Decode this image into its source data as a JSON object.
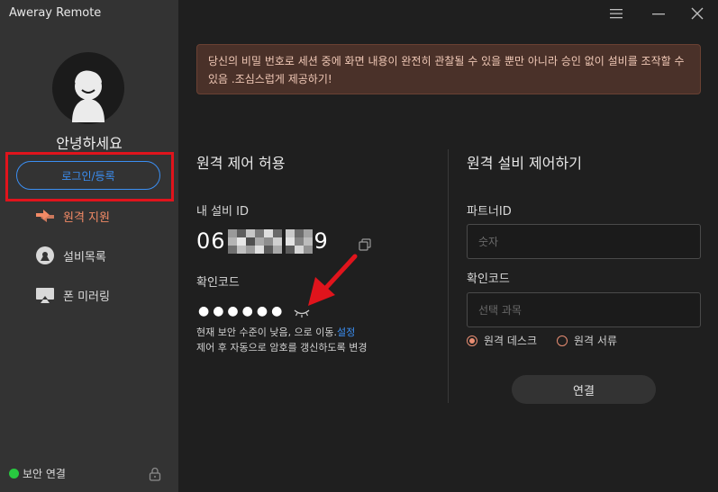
{
  "app": {
    "title": "Aweray Remote"
  },
  "sidebar": {
    "greeting": "안녕하세요",
    "login_label": "로그인/등록",
    "items": [
      {
        "label": "원격 지원",
        "icon": "remote-support-icon",
        "active": true
      },
      {
        "label": "설비목록",
        "icon": "device-list-icon",
        "active": false
      },
      {
        "label": "폰 미러링",
        "icon": "phone-mirroring-icon",
        "active": false
      }
    ],
    "status": "보안 연결"
  },
  "window_controls": [
    "menu-icon",
    "minimize-icon",
    "close-icon"
  ],
  "warning": "당신의 비밀 번호로 세션 중에 화면 내용이 완전히 관찰될 수 있을 뿐만 아니라 승인 없이 설비를 조작할 수 있음 .조심스럽게 제공하기!",
  "allow": {
    "title": "원격 제어 허용",
    "device_id_label": "내 설비 ID",
    "device_id_prefix": "06",
    "device_id_suffix": "9",
    "code_label": "확인코드",
    "code_masked": "●●●●●●",
    "hint_line1": "현재 보안 수준이 낮음, 으로 이동.",
    "hint_link": "설정",
    "hint_line2": "제어 후 자동으로 암호를 갱신하도록 변경"
  },
  "control": {
    "title": "원격 설비 제어하기",
    "partner_label": "파트너ID",
    "partner_placeholder": "숫자",
    "code_label": "확인코드",
    "code_placeholder": "선택 과목",
    "radio_desktop": "원격 데스크",
    "radio_files": "원격 서류",
    "connect_label": "연결"
  },
  "colors": {
    "accent": "#3b8ff3",
    "active_nav": "#f28a66",
    "highlight_outline": "#e0141c",
    "status_green": "#28c940",
    "arrow_red": "#e0141c"
  }
}
